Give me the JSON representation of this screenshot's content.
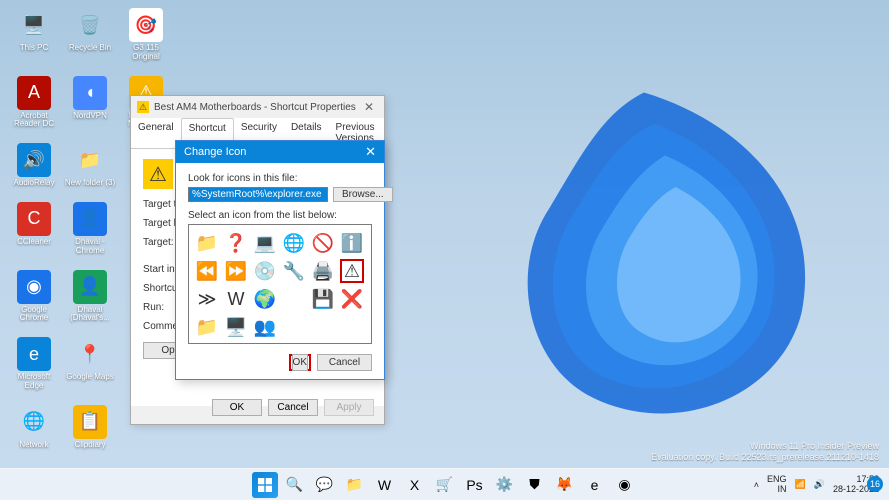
{
  "desktop_icons": [
    {
      "label": "This PC",
      "glyph": "🖥️",
      "bg": "trans"
    },
    {
      "label": "Recycle Bin",
      "glyph": "🗑️",
      "bg": "trans"
    },
    {
      "label": "G3 115 Original",
      "glyph": "🎯",
      "bg": ""
    },
    {
      "label": "Acrobat Reader DC",
      "glyph": "A",
      "bg": "",
      "color": "#b30b00"
    },
    {
      "label": "NordVPN",
      "glyph": "◖",
      "bg": "",
      "color": "#4687ff"
    },
    {
      "label": "Best AM4 Motherb...",
      "glyph": "⚠",
      "bg": "",
      "color": "#f7b500"
    },
    {
      "label": "AudioRelay",
      "glyph": "🔊",
      "bg": "",
      "color": "#0a84d8"
    },
    {
      "label": "New folder (3)",
      "glyph": "📁",
      "bg": "trans"
    },
    {
      "label": "",
      "glyph": "",
      "bg": "trans"
    },
    {
      "label": "CCleaner",
      "glyph": "C",
      "bg": "",
      "color": "#d93025"
    },
    {
      "label": "Dhaval - Chrome",
      "glyph": "👤",
      "bg": "",
      "color": "#1a73e8"
    },
    {
      "label": "",
      "glyph": "",
      "bg": "trans"
    },
    {
      "label": "Google Chrome",
      "glyph": "◉",
      "bg": "trans",
      "color": "#1a73e8"
    },
    {
      "label": "Dhaval (Dhaval's...",
      "glyph": "👤",
      "bg": "",
      "color": "#1a9e5c"
    },
    {
      "label": "",
      "glyph": "",
      "bg": "trans"
    },
    {
      "label": "Microsoft Edge",
      "glyph": "e",
      "bg": "",
      "color": "#0a84d8"
    },
    {
      "label": "Google Maps",
      "glyph": "📍",
      "bg": "trans"
    },
    {
      "label": "",
      "glyph": "",
      "bg": "trans"
    },
    {
      "label": "Network",
      "glyph": "🌐",
      "bg": "trans"
    },
    {
      "label": "Clipdiary",
      "glyph": "📋",
      "bg": "",
      "color": "#f7b500"
    }
  ],
  "properties": {
    "title": "Best AM4 Motherboards - Shortcut Properties",
    "tabs": [
      "General",
      "Shortcut",
      "Security",
      "Details",
      "Previous Versions"
    ],
    "active_tab": "Shortcut",
    "fields": {
      "target_type": "Target type:",
      "target_loc": "Target loc",
      "target": "Target:",
      "start_in": "Start in:",
      "shortcut_key": "Shortcut ke",
      "run": "Run:",
      "comment": "Comment:"
    },
    "open_file_location": "Open F",
    "ok": "OK",
    "cancel": "Cancel",
    "apply": "Apply"
  },
  "change_icon": {
    "title": "Change Icon",
    "look_label": "Look for icons in this file:",
    "path_value": "%SystemRoot%\\explorer.exe",
    "browse": "Browse...",
    "select_label": "Select an icon from the list below:",
    "icons": [
      "📁",
      "❓",
      "💻",
      "🌐",
      "🚫",
      "ℹ️",
      "⏪",
      "⏩",
      "💿",
      "🔧",
      "🖨️",
      "⚠",
      "≫",
      "W",
      "🌍",
      "",
      "💾",
      "❌",
      "📁",
      "🖥️",
      "👥",
      ""
    ],
    "selected_index": 11,
    "ok": "OK",
    "cancel": "Cancel"
  },
  "taskbar": {
    "apps": [
      "",
      "🔍",
      "💬",
      "📁",
      "W",
      "X",
      "🛒",
      "Ps",
      "⚙️",
      "⛊",
      "🦊",
      "e",
      "◉"
    ],
    "lang1": "ENG",
    "lang2": "IN",
    "time": "17:58",
    "date": "28-12-2021",
    "notif": "16"
  },
  "watermark": {
    "line1": "Windows 11 Pro Insider Preview",
    "line2": "Evaluation copy. Build 22523.rs_prerelease.211210-1418"
  }
}
